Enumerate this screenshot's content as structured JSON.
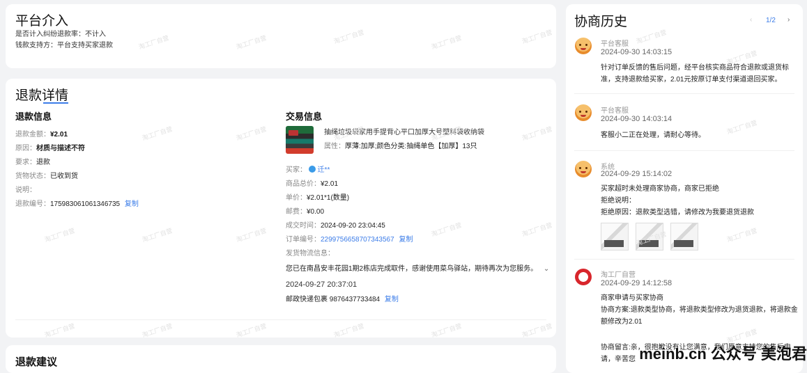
{
  "platform": {
    "title": "平台介入",
    "line1": "是否计入纠纷退款率：不计入",
    "line2": "钱款支持方：平台支持买家退款"
  },
  "refund": {
    "title": "退款详情",
    "info_title": "退款信息",
    "amount_label": "退款金额：",
    "amount": "¥2.01",
    "reason_label": "原因：",
    "reason": "材质与描述不符",
    "request_label": "要求：",
    "request": "退款",
    "goods_status_label": "货物状态：",
    "goods_status": "已收到货",
    "note_label": "说明：",
    "refund_no_label": "退款编号：",
    "refund_no": "175983061061346735",
    "copy": "复制"
  },
  "trade": {
    "title": "交易信息",
    "product_name": "抽绳垃圾袋家用手提背心平口加厚大号塑料袋收纳袋",
    "attr_label": "属性：",
    "attr_value": "厚薄:加厚;颜色分类:抽绳单色【加厚】13只",
    "buyer_label": "买家：",
    "buyer": "迁**",
    "total_label": "商品总价：",
    "total": "¥2.01",
    "unit_label": "单价：",
    "unit": "¥2.01*1(数量)",
    "postage_label": "邮费：",
    "postage": "¥0.00",
    "deal_time_label": "成交时间：",
    "deal_time": "2024-09-20 23:04:45",
    "order_no_label": "订单编号：",
    "order_no": "2299756658707343567",
    "copy": "复制",
    "logistics_label": "发货物流信息：",
    "logistics_msg": "您已在南昌安丰花园1期2栋店完成取件，感谢使用菜鸟驿站，期待再次为您服务。",
    "logistics_time": "2024-09-27 20:37:01",
    "express_label": "邮政快递包裹",
    "express_no": "9876437733484"
  },
  "suggest": {
    "title": "退款建议"
  },
  "history": {
    "title": "协商历史",
    "pager": "1/2",
    "items": [
      {
        "name": "平台客服",
        "time": "2024-09-30 14:03:15",
        "text1": "针对订单反馈的售后问题，经平台核实商品符合退款或退货标",
        "text2": "准，支持退款给买家，2.01元按原订单支付渠道退回买家。"
      },
      {
        "name": "平台客服",
        "time": "2024-09-30 14:03:14",
        "text1": "客服小二正在处理，请耐心等待。"
      },
      {
        "name": "系统",
        "time": "2024-09-29 15:14:02",
        "text1": "买家超时未处理商家协商，商家已拒绝",
        "text2": "拒绝说明：",
        "text3": "拒绝原因：退款类型选错，请修改为我要退货退款"
      },
      {
        "name": "淘工厂自营",
        "time": "2024-09-29 14:12:58",
        "text1": "商家申请与买家协商",
        "text2": "协商方案:退款类型协商，将退款类型修改为退货退款，将退款金",
        "text3": "额修改为2.01",
        "text4": "协商留言:亲，很抱歉没有让您满意，我们愿意支持您的售后申",
        "text5": "请，辛苦您"
      }
    ]
  },
  "watermark_text": "淘工厂自营",
  "brand_overlay": "meinb.cn 公众号 美泡君"
}
